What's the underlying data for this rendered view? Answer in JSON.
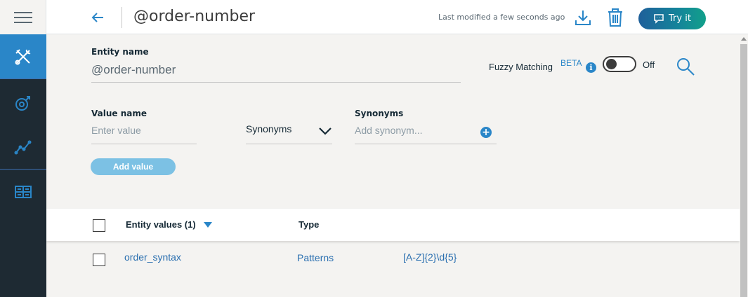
{
  "header": {
    "title": "@order-number",
    "last_modified": "Last modified a few seconds ago",
    "try_label": "Try it"
  },
  "rail": {
    "items": [
      {
        "icon": "tools-icon",
        "active": true
      },
      {
        "icon": "intent-icon",
        "active": false
      },
      {
        "icon": "analytics-icon",
        "active": false
      },
      {
        "icon": "dashboard-icon",
        "active": false
      }
    ]
  },
  "form": {
    "entity_name_label": "Entity name",
    "entity_name_value": "@order-number",
    "fuzzy_label": "Fuzzy Matching",
    "fuzzy_badge": "BETA",
    "fuzzy_state": "Off",
    "value_name_label": "Value name",
    "value_placeholder": "Enter value",
    "type_selected": "Synonyms",
    "synonyms_label": "Synonyms",
    "synonym_placeholder": "Add synonym...",
    "add_value_label": "Add value"
  },
  "table": {
    "headers": [
      "Entity values (1)",
      "Type"
    ],
    "rows": [
      {
        "value": "order_syntax",
        "type": "Patterns",
        "pattern": "[A-Z]{2}\\d{5}"
      }
    ]
  },
  "colors": {
    "accent": "#2a86c8",
    "rail": "#1e2a33",
    "link": "#2a6fb0"
  }
}
